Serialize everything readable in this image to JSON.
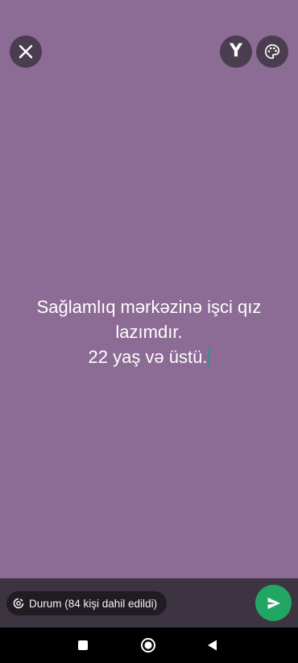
{
  "toolbar": {
    "close_icon": "close-icon",
    "font_button_label": "Y",
    "palette_icon": "palette-icon"
  },
  "status": {
    "lines": [
      "Sağlamlıq mərkəzinə işci qız",
      "lazımdır.",
      "22 yaş və üstü."
    ],
    "background_color": "#8c6b94",
    "text_color": "#ffffff"
  },
  "composer": {
    "audience_label": "Durum (84 kişi dahil edildi)",
    "audience_icon": "status-ring-icon",
    "send_icon": "send-icon",
    "send_color": "#22a663"
  },
  "navigation": {
    "recents_icon": "recents-square-icon",
    "home_icon": "home-circle-icon",
    "back_icon": "back-triangle-icon"
  }
}
